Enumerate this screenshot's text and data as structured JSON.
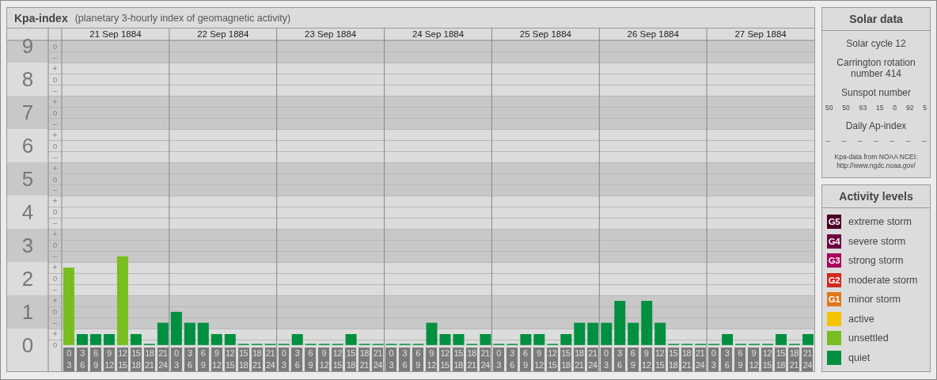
{
  "header": {
    "title": "Kpa-index",
    "subtitle": "(planetary 3-hourly index of geomagnetic activity)"
  },
  "dates": [
    "21 Sep 1884",
    "22 Sep 1884",
    "23 Sep 1884",
    "24 Sep 1884",
    "25 Sep 1884",
    "26 Sep 1884",
    "27 Sep 1884"
  ],
  "kp_subdivisions": [
    "o",
    "–",
    "+",
    "o",
    "–",
    "+",
    "o",
    "–",
    "+",
    "o",
    "–",
    "+",
    "o",
    "–",
    "+",
    "o",
    "–",
    "+",
    "o",
    "–",
    "+",
    "o",
    "–",
    "+",
    "o",
    "–",
    "+",
    "o"
  ],
  "chart_data": {
    "type": "bar",
    "categories": [
      "0 3",
      "3 6",
      "6 9",
      "9 12",
      "12 15",
      "15 18",
      "18 21",
      "21 24",
      "0 3",
      "3 6",
      "6 9",
      "9 12",
      "12 15",
      "15 18",
      "18 21",
      "21 24",
      "0 3",
      "3 6",
      "6 9",
      "9 12",
      "12 15",
      "15 18",
      "18 21",
      "21 24",
      "0 3",
      "3 6",
      "6 9",
      "9 12",
      "12 15",
      "15 18",
      "18 21",
      "21 24",
      "0 3",
      "3 6",
      "6 9",
      "9 12",
      "12 15",
      "15 18",
      "18 21",
      "21 24",
      "0 3",
      "3 6",
      "6 9",
      "9 12",
      "12 15",
      "15 18",
      "18 21",
      "21 24",
      "0 3",
      "3 6",
      "6 9",
      "9 12",
      "12 15",
      "15 18",
      "18 21",
      "21 24"
    ],
    "series": [
      {
        "color": "#009040",
        "values": [
          null,
          0.33,
          0.33,
          0.33,
          null,
          0.33,
          0,
          0.67,
          1,
          0.67,
          0.67,
          0.33,
          0.33,
          0,
          0,
          0,
          0,
          0.33,
          0,
          0,
          0,
          0.33,
          0,
          0,
          0,
          0,
          0,
          0.67,
          0.33,
          0.33,
          0,
          0.33,
          0,
          0,
          0.33,
          0.33,
          0,
          0.33,
          0.67,
          0.67,
          0.67,
          1.33,
          0.67,
          1.33,
          0.67,
          0,
          0,
          0,
          0,
          0.33,
          0,
          0,
          0,
          0.33,
          0,
          0.33
        ]
      },
      {
        "color": "#78be20",
        "values": [
          2.33,
          null,
          null,
          null,
          2.67,
          null,
          null,
          null,
          null,
          null,
          null,
          null,
          null,
          null,
          null,
          null,
          null,
          null,
          null,
          null,
          null,
          null,
          null,
          null,
          null,
          null,
          null,
          null,
          null,
          null,
          null,
          null,
          null,
          null,
          null,
          null,
          null,
          null,
          null,
          null,
          null,
          null,
          null,
          null,
          null,
          null,
          null,
          null,
          null,
          null,
          null,
          null,
          null,
          null,
          null,
          null
        ]
      }
    ],
    "ylim": [
      -0.79,
      9.17
    ],
    "yticks": [
      {
        "value": 9,
        "label": "9"
      },
      {
        "value": 8,
        "label": "8"
      },
      {
        "value": 7,
        "label": "7"
      },
      {
        "value": 6,
        "label": "6"
      },
      {
        "value": 5,
        "label": "5"
      },
      {
        "value": 4,
        "label": "4"
      },
      {
        "value": 3,
        "label": "3"
      },
      {
        "value": 2,
        "label": "2"
      },
      {
        "value": 1,
        "label": "1"
      },
      {
        "value": 0,
        "label": "0"
      }
    ]
  },
  "solar_data": {
    "title": "Solar data",
    "cycle": "Solar cycle 12",
    "rotation": "Carrington rotation number 414",
    "sunspot_label": "Sunspot number",
    "sunspot_numbers": [
      "50",
      "50",
      "63",
      "15",
      "0",
      "92",
      "5"
    ],
    "ap_label": "Daily Ap-index",
    "ap_values": [
      "--",
      "--",
      "--",
      "--",
      "--",
      "--",
      "--"
    ],
    "source": "Kpa-data from NOAA NCEI: http://www.ngdc.noaa.gov/"
  },
  "activity_levels": {
    "title": "Activity levels",
    "items": [
      {
        "badge": "G5",
        "label": "extreme storm",
        "color": "#4a0025"
      },
      {
        "badge": "G4",
        "label": "severe storm",
        "color": "#6e0040"
      },
      {
        "badge": "G3",
        "label": "strong storm",
        "color": "#a8005c"
      },
      {
        "badge": "G2",
        "label": "moderate storm",
        "color": "#d22a1e"
      },
      {
        "badge": "G1",
        "label": "minor storm",
        "color": "#e0761a"
      },
      {
        "label": "active",
        "color": "#f5c400"
      },
      {
        "label": "unsettled",
        "color": "#78be20"
      },
      {
        "label": "quiet",
        "color": "#009040"
      }
    ]
  }
}
